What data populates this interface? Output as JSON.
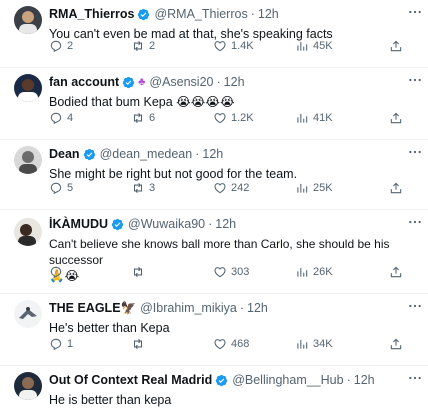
{
  "tweets": [
    {
      "name": "RMA_Thierros",
      "badge": "",
      "handle": "@RMA_Thierros",
      "time": "12h",
      "text": "You can't even be mad at that, she's speaking facts",
      "text2": "",
      "replies": "2",
      "retweets": "2",
      "likes": "1.4K",
      "views": "45K",
      "avatar_icon": "avatar-image"
    },
    {
      "name": "fan account",
      "badge": "♣",
      "handle": "@Asensi20",
      "time": "12h",
      "text": "Bodied that bum Kepa 😭😭😭😭",
      "text2": "",
      "replies": "4",
      "retweets": "6",
      "likes": "1.2K",
      "views": "41K",
      "avatar_icon": "avatar-image"
    },
    {
      "name": "Dean",
      "badge": "",
      "handle": "@dean_medean",
      "time": "12h",
      "text": "She might be right but not good for the team.",
      "text2": "",
      "replies": "5",
      "retweets": "3",
      "likes": "242",
      "views": "25K",
      "avatar_icon": "avatar-image"
    },
    {
      "name": "İKÀMUDU",
      "badge": "",
      "handle": "@Wuwaika90",
      "time": "12h",
      "text": "Can't believe she knows ball more than Carlo, she should be his successor",
      "text2": "🙏😭",
      "replies": "",
      "retweets": "",
      "likes": "303",
      "views": "26K",
      "avatar_icon": "avatar-image"
    },
    {
      "name": "THE EAGLE🦅",
      "badge": "",
      "handle": "@Ibrahim_mikiya",
      "time": "12h",
      "text": "He's better than Kepa",
      "text2": "",
      "replies": "1",
      "retweets": "",
      "likes": "468",
      "views": "34K",
      "avatar_icon": "avatar-image"
    },
    {
      "name": "Out Of Context Real Madrid",
      "badge": "",
      "handle": "@Bellingham__Hub",
      "time": "12h",
      "text": "He is better than kepa",
      "text2": "",
      "replies": "",
      "retweets": "",
      "likes": "",
      "views": "",
      "avatar_icon": "avatar-image"
    }
  ],
  "colors": {
    "verified": "#1d9bf0",
    "secondary_text": "#536471",
    "divider": "#eff3f4",
    "badge_purple": "#b44fd6"
  }
}
